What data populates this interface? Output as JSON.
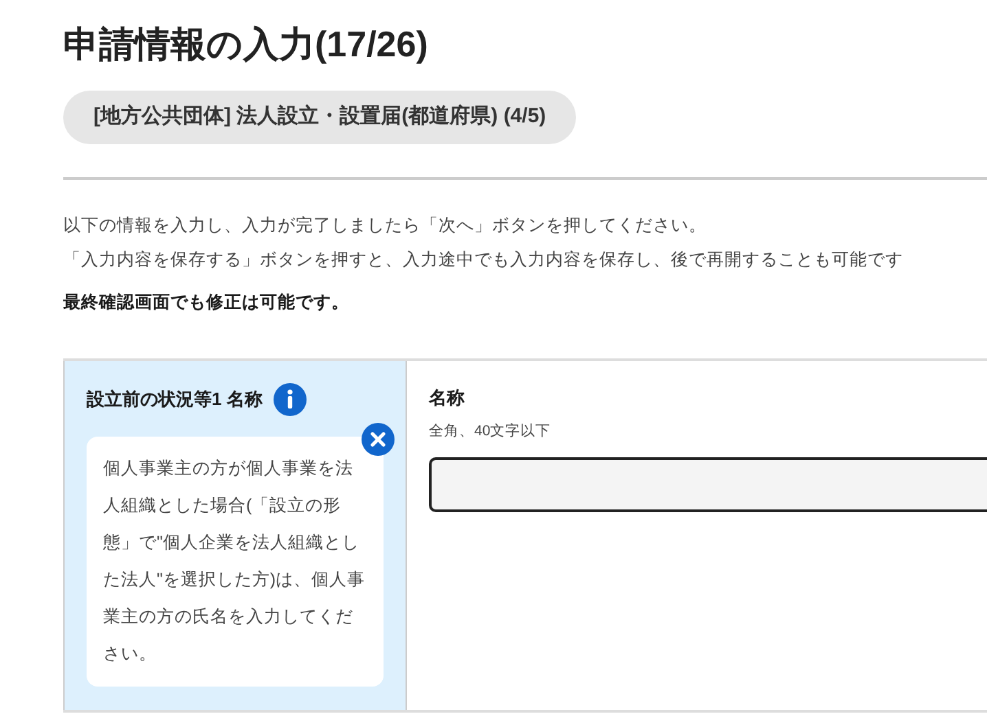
{
  "page_title": "申請情報の入力(17/26)",
  "procedure_pill": "[地方公共団体] 法人設立・設置届(都道府県) (4/5)",
  "instructions": [
    "以下の情報を入力し、入力が完了しましたら「次へ」ボタンを押してください。",
    "「入力内容を保存する」ボタンを押すと、入力途中でも入力内容を保存し、後で再開することも可能です"
  ],
  "note": "最終確認画面でも修正は可能です。",
  "form_row": {
    "label": "設立前の状況等1 名称",
    "help_open": true,
    "help_text": "個人事業主の方が個人事業を法人組織とした場合(「設立の形態」で\"個人企業を法人組織とした法人\"を選択した方)は、個人事業主の方の氏名を入力してください。",
    "field_label": "名称",
    "field_hint": "全角、40文字以下"
  }
}
